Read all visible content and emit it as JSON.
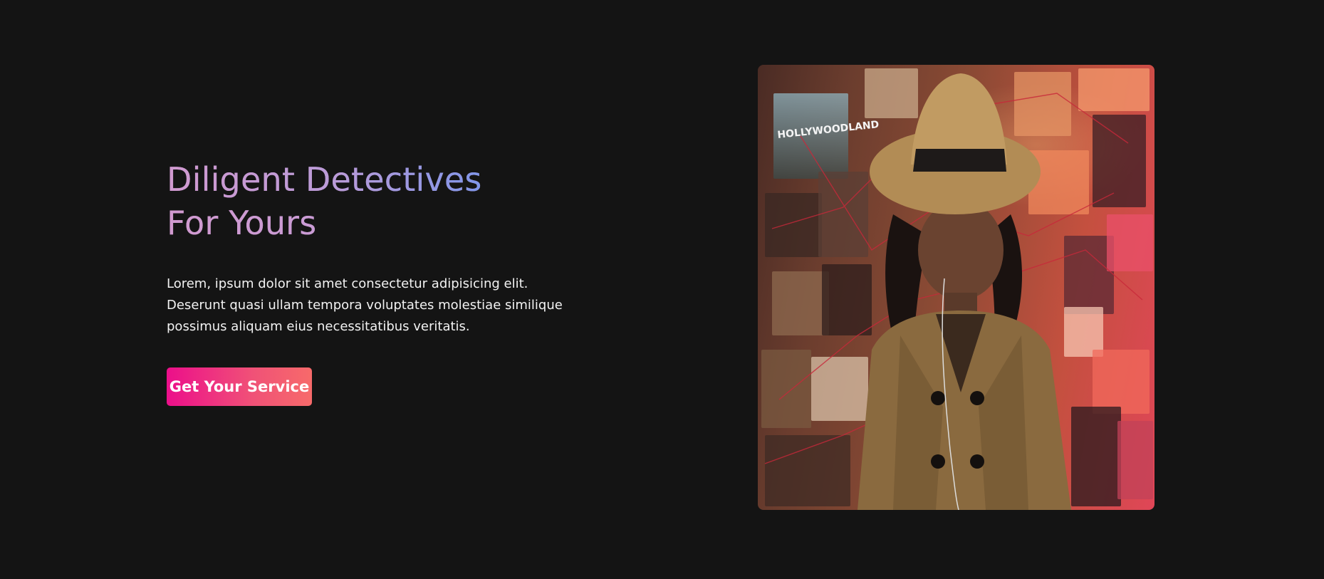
{
  "hero": {
    "title_line1": "Diligent Detectives",
    "title_line2": "For Yours",
    "description": "Lorem, ipsum dolor sit amet consectetur adipisicing elit. Deserunt quasi ullam tempora voluptates molestiae similique possimus aliquam eius necessitatibus veritatis.",
    "cta_label": "Get Your Service",
    "image_caption_text": "HOLLYWOODLAND"
  },
  "colors": {
    "background": "#141414",
    "title_gradient_start": "#d19ad0",
    "title_gradient_end": "#7f96ea",
    "button_gradient_start": "#ec0f8a",
    "button_gradient_end": "#f76a6a"
  }
}
